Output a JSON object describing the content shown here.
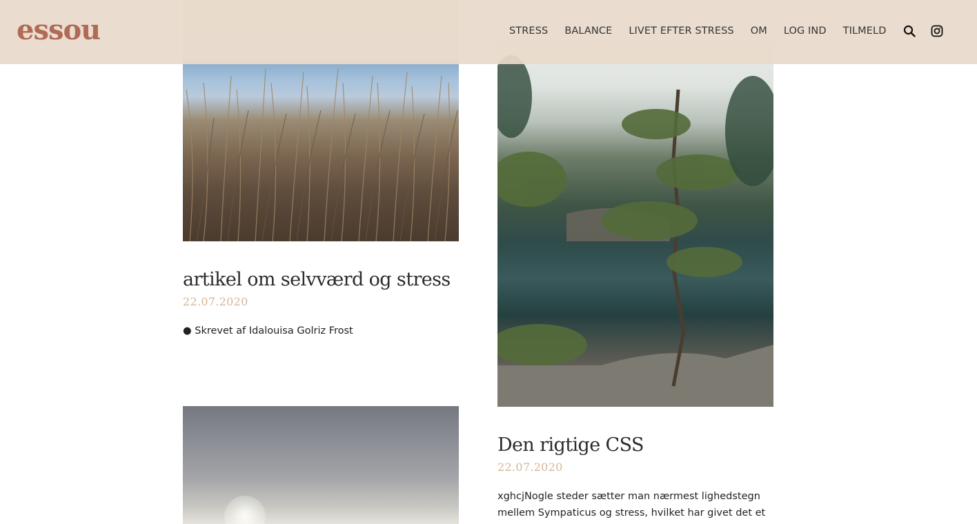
{
  "header": {
    "logo": "essou",
    "nav": {
      "stress": "STRESS",
      "balance": "BALANCE",
      "livet": "LIVET EFTER STRESS",
      "om": "OM",
      "login": "LOG IND",
      "tilmeld": "TILMELD"
    },
    "icons": [
      "search-icon",
      "instagram-icon"
    ]
  },
  "colors": {
    "header_bg": "#e8dacb",
    "logo": "#b06a56",
    "date": "#d4b596"
  },
  "articles": [
    {
      "title": "artikel om selvværd og stress",
      "date": "22.07.2020",
      "excerpt": "● Skrevet af Idalouisa Golriz Frost"
    },
    {
      "title": "Den rigtige CSS",
      "date": "22.07.2020",
      "excerpt": "xghcjNogle steder sætter man nærmest lighedstegn mellem Sympaticus og stress, hvilket har givet det et"
    }
  ]
}
